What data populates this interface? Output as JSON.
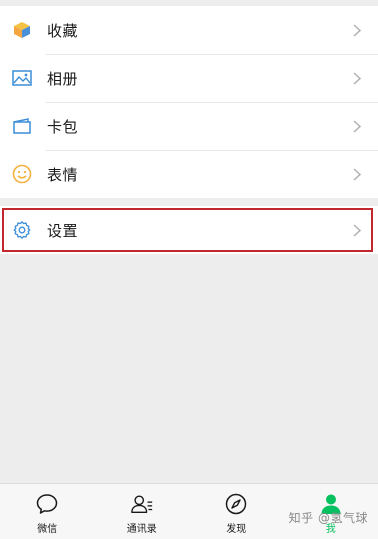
{
  "menu": {
    "items": [
      {
        "label": "收藏",
        "icon": "cube-icon"
      },
      {
        "label": "相册",
        "icon": "image-icon"
      },
      {
        "label": "卡包",
        "icon": "card-icon"
      },
      {
        "label": "表情",
        "icon": "smile-icon"
      }
    ],
    "settings": {
      "label": "设置",
      "icon": "gear-icon"
    }
  },
  "tabbar": {
    "tabs": [
      {
        "label": "微信",
        "icon": "chat-bubble-icon"
      },
      {
        "label": "通讯录",
        "icon": "contacts-icon"
      },
      {
        "label": "发现",
        "icon": "compass-icon"
      },
      {
        "label": "我",
        "icon": "person-icon",
        "active": true
      }
    ]
  },
  "watermark": "知乎 @氢气球",
  "colors": {
    "accent": "#07c160",
    "highlight_border": "#c1272d",
    "background": "#ededed"
  }
}
